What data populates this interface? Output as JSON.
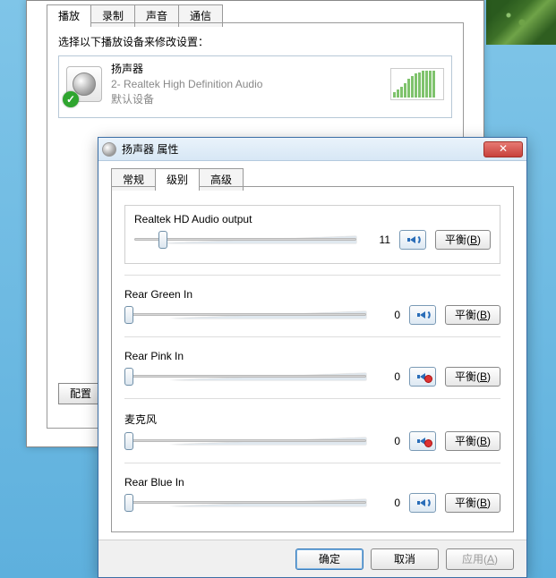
{
  "main": {
    "tabs": [
      "播放",
      "录制",
      "声音",
      "通信"
    ],
    "active_tab": 0,
    "instruction": "选择以下播放设备来修改设置：",
    "device": {
      "name": "扬声器",
      "subtitle": "2- Realtek High Definition Audio",
      "default_label": "默认设备"
    },
    "config_button": "配置"
  },
  "prop": {
    "title": "扬声器 属性",
    "tabs": [
      "常规",
      "级别",
      "高级"
    ],
    "active_tab": 1,
    "channels": [
      {
        "label": "Realtek HD Audio output",
        "value": 11,
        "muted": false,
        "percent": 11,
        "boxed": true
      },
      {
        "label": "Rear Green In",
        "value": 0,
        "muted": false,
        "percent": 0
      },
      {
        "label": "Rear Pink In",
        "value": 0,
        "muted": true,
        "percent": 0
      },
      {
        "label": "麦克风",
        "value": 0,
        "muted": true,
        "percent": 0
      },
      {
        "label": "Rear Blue In",
        "value": 0,
        "muted": false,
        "percent": 0
      }
    ],
    "balance_label": "平衡",
    "balance_key": "B",
    "footer": {
      "ok": "确定",
      "cancel": "取消",
      "apply": "应用",
      "apply_key": "A"
    }
  }
}
